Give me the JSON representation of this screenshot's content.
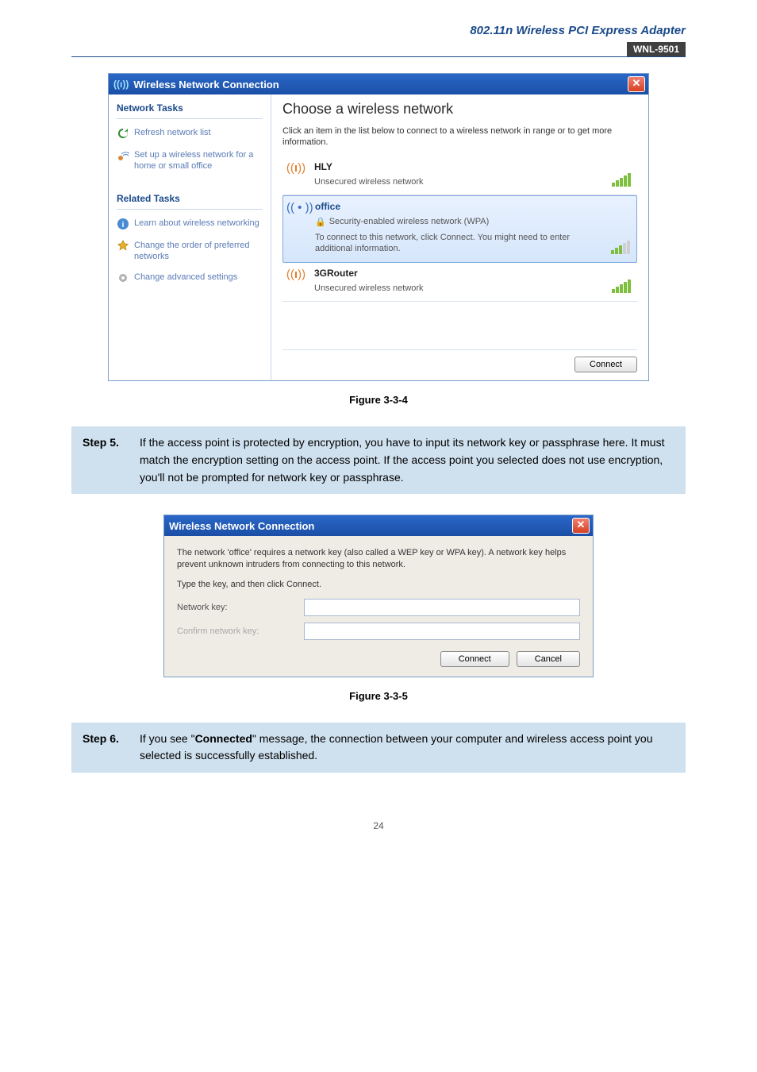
{
  "header": {
    "title": "802.11n Wireless PCI Express Adapter",
    "badge": "WNL-9501"
  },
  "fig1": {
    "window_title": "Wireless Network Connection",
    "sidebar": {
      "section1_title": "Network Tasks",
      "links1": [
        {
          "label": "Refresh network list"
        },
        {
          "label": "Set up a wireless network for a home or small office"
        }
      ],
      "section2_title": "Related Tasks",
      "links2": [
        {
          "label": "Learn about wireless networking"
        },
        {
          "label": "Change the order of preferred networks"
        },
        {
          "label": "Change advanced settings"
        }
      ]
    },
    "main": {
      "heading": "Choose a wireless network",
      "description": "Click an item in the list below to connect to a wireless network in range or to get more information.",
      "networks": [
        {
          "name": "HLY",
          "sub": "Unsecured wireless network",
          "selected": false,
          "secure": false
        },
        {
          "name": "office",
          "sub": "Security-enabled wireless network (WPA)",
          "extra": "To connect to this network, click Connect. You might need to enter additional information.",
          "selected": true,
          "secure": true
        },
        {
          "name": "3GRouter",
          "sub": "Unsecured wireless network",
          "selected": false,
          "secure": false
        }
      ],
      "connect_label": "Connect"
    }
  },
  "caption1": "Figure 3-3-4",
  "step5": {
    "label": "Step 5.",
    "text": "If the access point is protected by encryption, you have to input its network key or passphrase here. It must match the encryption setting on the access point. If the access point you selected does not use encryption, you'll not be prompted for network key or passphrase."
  },
  "fig2": {
    "window_title": "Wireless Network Connection",
    "p1": "The network 'office' requires a network key (also called a WEP key or WPA key). A network key helps prevent unknown intruders from connecting to this network.",
    "p2": "Type the key, and then click Connect.",
    "label_key": "Network key:",
    "label_confirm": "Confirm network key:",
    "btn_connect": "Connect",
    "btn_cancel": "Cancel"
  },
  "caption2": "Figure 3-3-5",
  "step6": {
    "label": "Step 6.",
    "text_before": "If you see \"",
    "text_bold": "Connected",
    "text_after": "\" message, the connection between your computer and wireless access point you selected is successfully established."
  },
  "page_num": "24"
}
